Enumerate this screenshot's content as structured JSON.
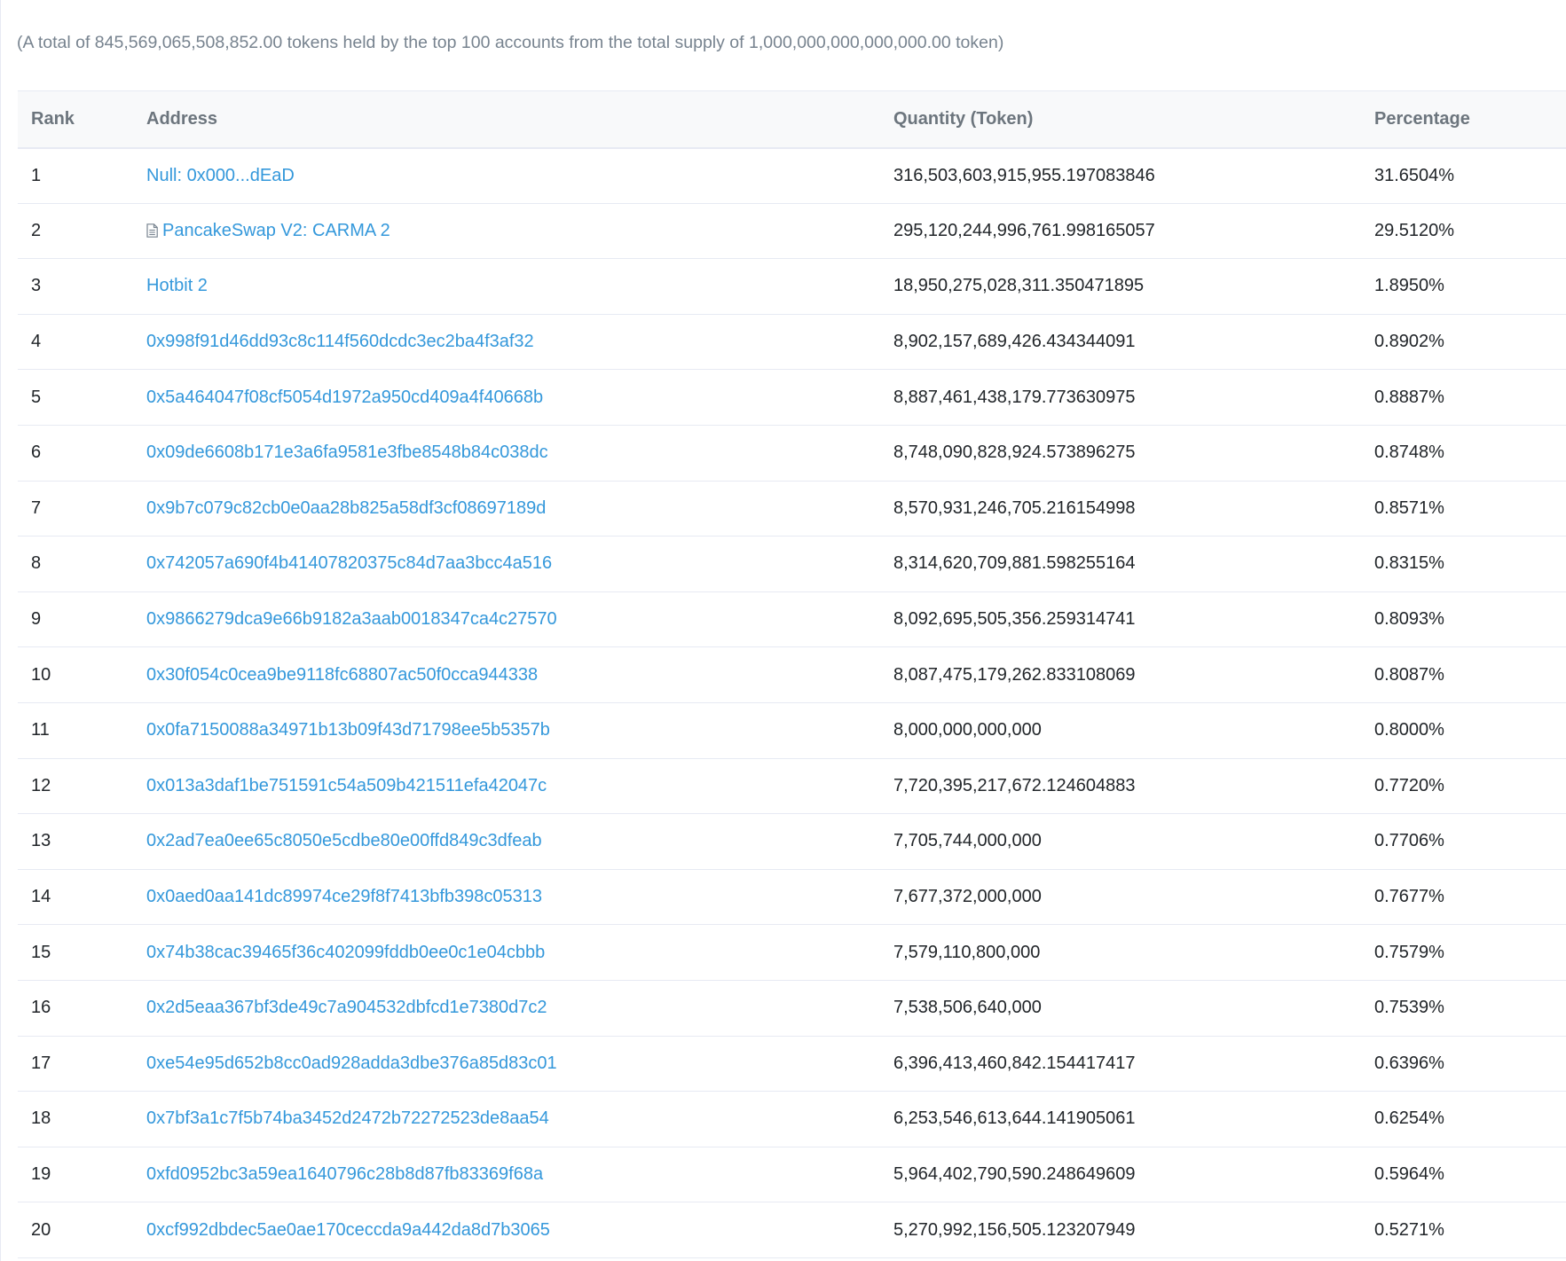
{
  "summary": "(A total of 845,569,065,508,852.00 tokens held by the top 100 accounts from the total supply of 1,000,000,000,000,000.00 token)",
  "columns": {
    "rank": "Rank",
    "address": "Address",
    "quantity": "Quantity (Token)",
    "percentage": "Percentage"
  },
  "rows": [
    {
      "rank": "1",
      "address": "Null: 0x000...dEaD",
      "is_contract": false,
      "quantity": "316,503,603,915,955.197083846",
      "percentage": "31.6504%"
    },
    {
      "rank": "2",
      "address": "PancakeSwap V2: CARMA 2",
      "is_contract": true,
      "quantity": "295,120,244,996,761.998165057",
      "percentage": "29.5120%"
    },
    {
      "rank": "3",
      "address": "Hotbit 2",
      "is_contract": false,
      "quantity": "18,950,275,028,311.350471895",
      "percentage": "1.8950%"
    },
    {
      "rank": "4",
      "address": "0x998f91d46dd93c8c114f560dcdc3ec2ba4f3af32",
      "is_contract": false,
      "quantity": "8,902,157,689,426.434344091",
      "percentage": "0.8902%"
    },
    {
      "rank": "5",
      "address": "0x5a464047f08cf5054d1972a950cd409a4f40668b",
      "is_contract": false,
      "quantity": "8,887,461,438,179.773630975",
      "percentage": "0.8887%"
    },
    {
      "rank": "6",
      "address": "0x09de6608b171e3a6fa9581e3fbe8548b84c038dc",
      "is_contract": false,
      "quantity": "8,748,090,828,924.573896275",
      "percentage": "0.8748%"
    },
    {
      "rank": "7",
      "address": "0x9b7c079c82cb0e0aa28b825a58df3cf08697189d",
      "is_contract": false,
      "quantity": "8,570,931,246,705.216154998",
      "percentage": "0.8571%"
    },
    {
      "rank": "8",
      "address": "0x742057a690f4b41407820375c84d7aa3bcc4a516",
      "is_contract": false,
      "quantity": "8,314,620,709,881.598255164",
      "percentage": "0.8315%"
    },
    {
      "rank": "9",
      "address": "0x9866279dca9e66b9182a3aab0018347ca4c27570",
      "is_contract": false,
      "quantity": "8,092,695,505,356.259314741",
      "percentage": "0.8093%"
    },
    {
      "rank": "10",
      "address": "0x30f054c0cea9be9118fc68807ac50f0cca944338",
      "is_contract": false,
      "quantity": "8,087,475,179,262.833108069",
      "percentage": "0.8087%"
    },
    {
      "rank": "11",
      "address": "0x0fa7150088a34971b13b09f43d71798ee5b5357b",
      "is_contract": false,
      "quantity": "8,000,000,000,000",
      "percentage": "0.8000%"
    },
    {
      "rank": "12",
      "address": "0x013a3daf1be751591c54a509b421511efa42047c",
      "is_contract": false,
      "quantity": "7,720,395,217,672.124604883",
      "percentage": "0.7720%"
    },
    {
      "rank": "13",
      "address": "0x2ad7ea0ee65c8050e5cdbe80e00ffd849c3dfeab",
      "is_contract": false,
      "quantity": "7,705,744,000,000",
      "percentage": "0.7706%"
    },
    {
      "rank": "14",
      "address": "0x0aed0aa141dc89974ce29f8f7413bfb398c05313",
      "is_contract": false,
      "quantity": "7,677,372,000,000",
      "percentage": "0.7677%"
    },
    {
      "rank": "15",
      "address": "0x74b38cac39465f36c402099fddb0ee0c1e04cbbb",
      "is_contract": false,
      "quantity": "7,579,110,800,000",
      "percentage": "0.7579%"
    },
    {
      "rank": "16",
      "address": "0x2d5eaa367bf3de49c7a904532dbfcd1e7380d7c2",
      "is_contract": false,
      "quantity": "7,538,506,640,000",
      "percentage": "0.7539%"
    },
    {
      "rank": "17",
      "address": "0xe54e95d652b8cc0ad928adda3dbe376a85d83c01",
      "is_contract": false,
      "quantity": "6,396,413,460,842.154417417",
      "percentage": "0.6396%"
    },
    {
      "rank": "18",
      "address": "0x7bf3a1c7f5b74ba3452d2472b72272523de8aa54",
      "is_contract": false,
      "quantity": "6,253,546,613,644.141905061",
      "percentage": "0.6254%"
    },
    {
      "rank": "19",
      "address": "0xfd0952bc3a59ea1640796c28b8d87fb83369f68a",
      "is_contract": false,
      "quantity": "5,964,402,790,590.248649609",
      "percentage": "0.5964%"
    },
    {
      "rank": "20",
      "address": "0xcf992dbdec5ae0ae170ceccda9a442da8d7b3065",
      "is_contract": false,
      "quantity": "5,270,992,156,505.123207949",
      "percentage": "0.5271%"
    }
  ],
  "colors": {
    "link": "#3498db",
    "muted_text": "#77838f",
    "header_text": "#6c757d",
    "header_bg": "#f8f9fa",
    "border": "#e7eaf3"
  },
  "icons": {
    "contract": "document-icon"
  }
}
